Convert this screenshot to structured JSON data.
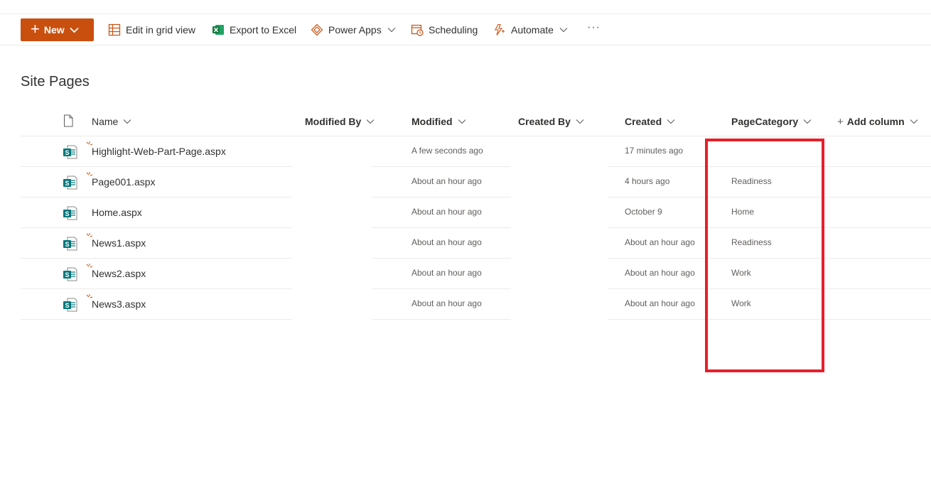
{
  "toolbar": {
    "new_label": "New",
    "grid_label": "Edit in grid view",
    "excel_label": "Export to Excel",
    "powerapps_label": "Power Apps",
    "scheduling_label": "Scheduling",
    "automate_label": "Automate",
    "more_label": "···"
  },
  "page": {
    "title": "Site Pages"
  },
  "columns": {
    "name": "Name",
    "modified_by": "Modified By",
    "modified": "Modified",
    "created_by": "Created By",
    "created": "Created",
    "page_category": "PageCategory",
    "add_column": "Add column"
  },
  "rows": [
    {
      "name": "Highlight-Web-Part-Page.aspx",
      "modified_by": "",
      "modified": "A few seconds ago",
      "created_by": "",
      "created": "17 minutes ago",
      "page_category": "",
      "is_new": true
    },
    {
      "name": "Page001.aspx",
      "modified_by": "",
      "modified": "About an hour ago",
      "created_by": "",
      "created": "4 hours ago",
      "page_category": "Readiness",
      "is_new": true
    },
    {
      "name": "Home.aspx",
      "modified_by": "",
      "modified": "About an hour ago",
      "created_by": "",
      "created": "October 9",
      "page_category": "Home",
      "is_new": false
    },
    {
      "name": "News1.aspx",
      "modified_by": "",
      "modified": "About an hour ago",
      "created_by": "",
      "created": "About an hour ago",
      "page_category": "Readiness",
      "is_new": true
    },
    {
      "name": "News2.aspx",
      "modified_by": "",
      "modified": "About an hour ago",
      "created_by": "",
      "created": "About an hour ago",
      "page_category": "Work",
      "is_new": true
    },
    {
      "name": "News3.aspx",
      "modified_by": "",
      "modified": "About an hour ago",
      "created_by": "",
      "created": "About an hour ago",
      "page_category": "Work",
      "is_new": true
    }
  ],
  "colors": {
    "accent": "#c94f0f",
    "highlight_box": "#e81e2a",
    "sharepoint_icon": "#03787c",
    "new_indicator": "#c94f0f"
  },
  "icons": {
    "grid": "grid-icon",
    "excel": "excel-icon",
    "powerapps": "power-apps-icon",
    "scheduling": "calendar-icon",
    "automate": "automate-icon",
    "file_header": "file-icon",
    "page": "sharepoint-page-icon"
  }
}
